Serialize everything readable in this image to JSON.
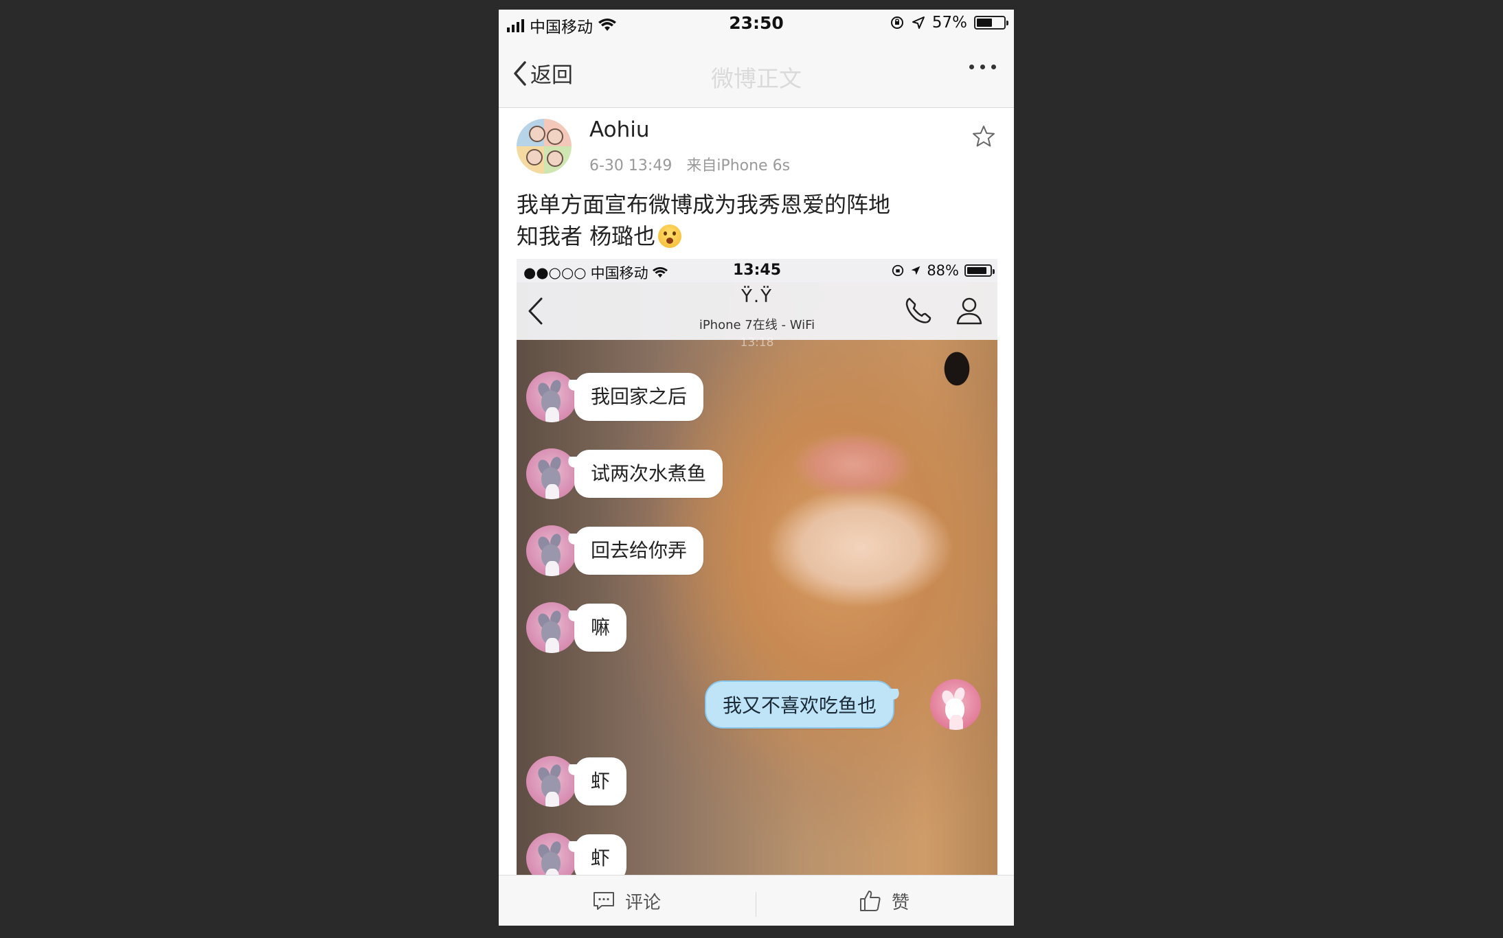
{
  "status_bar": {
    "carrier": "中国移动",
    "time": "23:50",
    "battery": "57%",
    "battery_level": 0.57
  },
  "nav": {
    "back_label": "返回",
    "title": "微博正文"
  },
  "post": {
    "username": "Aohiu",
    "timestamp": "6-30 13:49",
    "source": "来自iPhone 6s",
    "text_line1": "我单方面宣布微博成为我秀恩爱的阵地",
    "text_line2": "知我者 杨璐也"
  },
  "embedded_screenshot": {
    "status": {
      "signal": "●●○○○",
      "carrier": "中国移动",
      "time": "13:45",
      "battery": "88%",
      "battery_level": 0.88
    },
    "contact_name": "Ϋ.Ϋ",
    "contact_status": "iPhone 7在线 - WiFi",
    "message_time": "13:18",
    "messages": [
      {
        "text": "我回家之后",
        "side": "left"
      },
      {
        "text": "试两次水煮鱼",
        "side": "left"
      },
      {
        "text": "回去给你弄",
        "side": "left"
      },
      {
        "text": "嘛",
        "side": "left"
      },
      {
        "text": "我又不喜欢吃鱼也",
        "side": "right"
      },
      {
        "text": "虾",
        "side": "left"
      },
      {
        "text": "虾",
        "side": "left"
      }
    ]
  },
  "bottom_bar": {
    "comment_label": "评论",
    "like_label": "赞"
  }
}
